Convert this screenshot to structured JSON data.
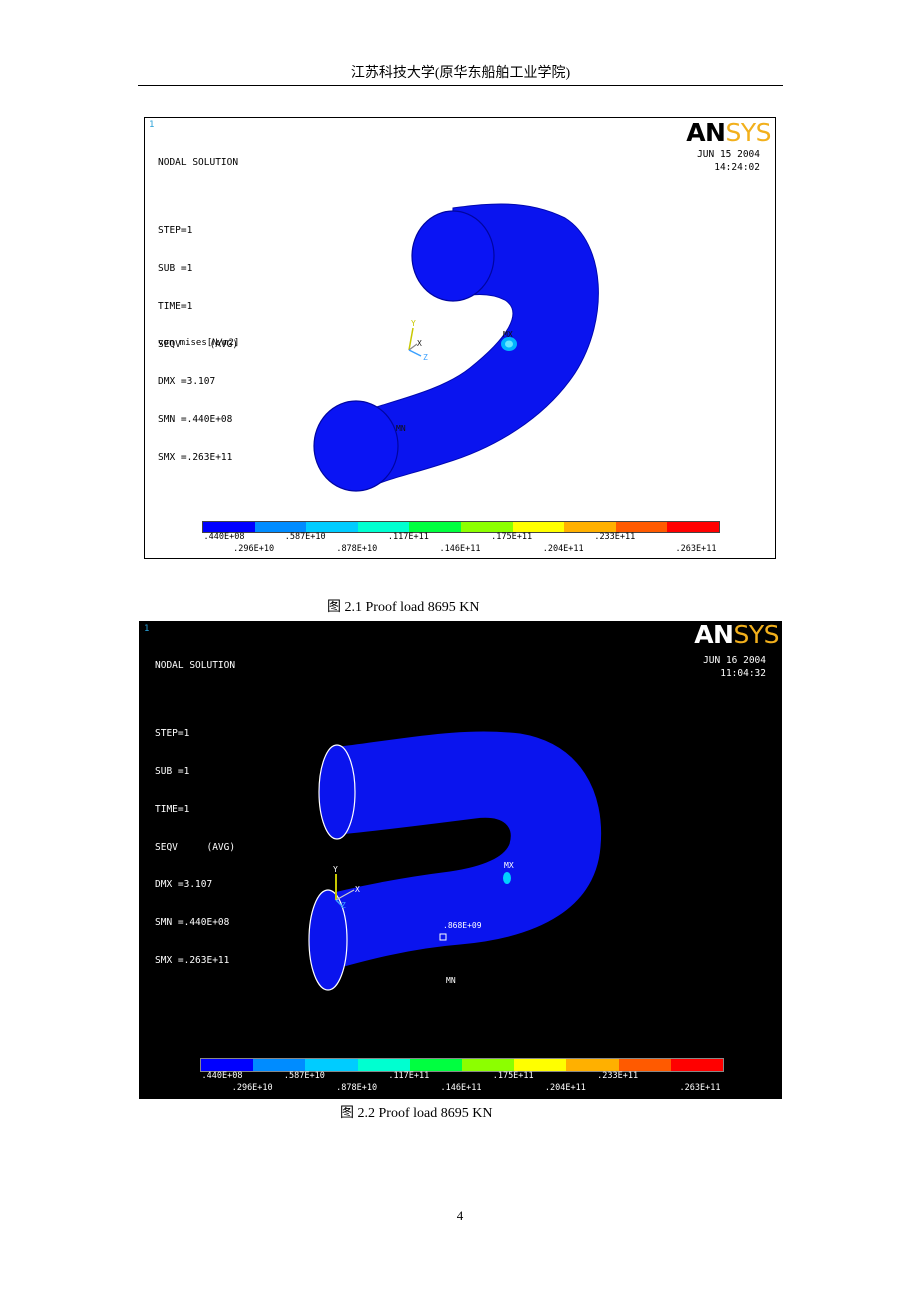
{
  "header": {
    "title": "江苏科技大学(原华东船舶工业学院)"
  },
  "figures": [
    {
      "corner": "1",
      "info": [
        "NODAL SOLUTION",
        "STEP=1",
        "SUB =1",
        "TIME=1",
        "SEQV     (AVG)",
        "DMX =3.107",
        "SMN =.440E+08",
        "SMX =.263E+11"
      ],
      "logo": {
        "a": "AN",
        "b": "SYS"
      },
      "date": "JUN 15 2004",
      "time": "14:24:02",
      "legend_label": "von mises[N/m2]",
      "axes": {
        "y": "Y",
        "x": "X",
        "z": "Z"
      },
      "tags": {
        "max": "MX",
        "min": "MN"
      },
      "caption": "图 2.1 Proof load 8695 KN"
    },
    {
      "corner": "1",
      "info": [
        "NODAL SOLUTION",
        "STEP=1",
        "SUB =1",
        "TIME=1",
        "SEQV     (AVG)",
        "DMX =3.107",
        "SMN =.440E+08",
        "SMX =.263E+11"
      ],
      "logo": {
        "a": "AN",
        "b": "SYS"
      },
      "date": "JUN 16 2004",
      "time": "11:04:32",
      "axes": {
        "y": "Y",
        "x": "X",
        "z": "Z"
      },
      "tags": {
        "max": "MX",
        "min": "MN",
        "probe": ".868E+09"
      },
      "caption": "图 2.2 Proof load 8695 KN"
    }
  ],
  "contour_scale": {
    "colors": [
      "#0000ff",
      "#008cff",
      "#00ccff",
      "#00ffd0",
      "#00ff40",
      "#8cff00",
      "#ffff00",
      "#ffb000",
      "#ff5a00",
      "#ff0000"
    ],
    "upper_labels": [
      ".440E+08",
      ".587E+10",
      ".117E+11",
      ".175E+11",
      ".233E+11"
    ],
    "lower_labels": [
      ".296E+10",
      ".878E+10",
      ".146E+11",
      ".204E+11",
      ".263E+11"
    ]
  },
  "page_number": "4"
}
